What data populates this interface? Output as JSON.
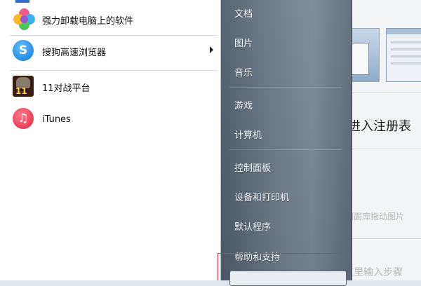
{
  "start_menu": {
    "programs": [
      {
        "label": "强力卸载电脑上的软件",
        "icon": "flower-app-icon",
        "has_submenu": false
      },
      {
        "label": "搜狗高速浏览器",
        "icon": "sogou-browser-icon",
        "has_submenu": true
      },
      {
        "label": "11对战平台",
        "icon": "11-platform-icon",
        "has_submenu": false
      },
      {
        "label": "iTunes",
        "icon": "itunes-icon",
        "has_submenu": false
      }
    ],
    "places": [
      {
        "label": "文档"
      },
      {
        "label": "图片"
      },
      {
        "label": "音乐"
      },
      {
        "label": "游戏"
      },
      {
        "label": "计算机"
      },
      {
        "label": "控制面板"
      },
      {
        "label": "设备和打印机"
      },
      {
        "label": "默认程序"
      },
      {
        "label": "帮助和支持"
      }
    ]
  },
  "background_window": {
    "heading": "进入注册表",
    "faded_text": "侧面库拖动图片",
    "faded_text_bottom": "这里输入步骤"
  },
  "colors": {
    "highlight_border": "#d23b3b",
    "places_pane": "#6b7885"
  }
}
